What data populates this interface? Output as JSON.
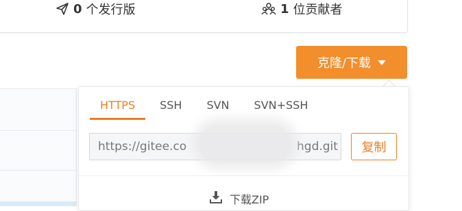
{
  "stats": {
    "releases": {
      "count": "0",
      "label": "个发行版",
      "icon": "send-icon"
    },
    "contributors": {
      "count": "1",
      "label": "位贡献者",
      "icon": "contributors-icon"
    }
  },
  "clone_button": {
    "label": "克隆/下载",
    "icon": "caret-down-icon"
  },
  "dropdown": {
    "tabs": [
      {
        "label": "HTTPS",
        "active": true
      },
      {
        "label": "SSH",
        "active": false
      },
      {
        "label": "SVN",
        "active": false
      },
      {
        "label": "SVN+SSH",
        "active": false
      }
    ],
    "url_prefix": "https://gitee.co",
    "url_suffix": "hgd.git",
    "copy_label": "复制",
    "download_zip_label": "下载ZIP",
    "download_icon": "download-icon"
  },
  "colors": {
    "accent": "#f28e2c",
    "accent_text": "#f07b20"
  }
}
